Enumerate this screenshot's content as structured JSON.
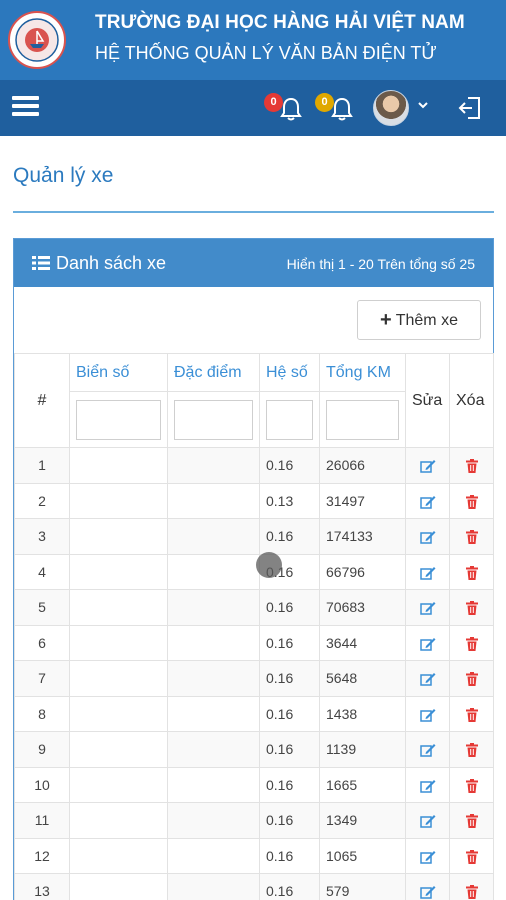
{
  "brand": {
    "title": "TRƯỜNG ĐẠI HỌC HÀNG HẢI VIỆT NAM",
    "subtitle": "HỆ THỐNG QUẢN LÝ VĂN BẢN ĐIỆN TỬ",
    "logo_icon": "university-seal-logo"
  },
  "navbar": {
    "menu_icon": "hamburger-icon",
    "notifications": [
      {
        "icon": "bell-icon",
        "count": "0",
        "color": "#e53935"
      },
      {
        "icon": "bell-icon",
        "count": "0",
        "color": "#e0a800"
      }
    ],
    "avatar_icon": "user-avatar",
    "logout_icon": "logout-icon"
  },
  "page": {
    "title": "Quản lý xe"
  },
  "panel": {
    "title": "Danh sách xe",
    "info": "Hiển thị 1 - 20 Trên tổng số 25",
    "add_button": "Thêm xe",
    "columns": [
      "#",
      "Biển số",
      "Đặc điểm",
      "Hệ số",
      "Tổng KM",
      "Sửa",
      "Xóa"
    ]
  },
  "rows": [
    {
      "n": "1",
      "plate": "",
      "feature": "",
      "coef": "0.16",
      "km": "26066"
    },
    {
      "n": "2",
      "plate": "",
      "feature": "",
      "coef": "0.13",
      "km": "31497"
    },
    {
      "n": "3",
      "plate": "",
      "feature": "",
      "coef": "0.16",
      "km": "174133"
    },
    {
      "n": "4",
      "plate": "",
      "feature": "",
      "coef": "0.16",
      "km": "66796"
    },
    {
      "n": "5",
      "plate": "",
      "feature": "",
      "coef": "0.16",
      "km": "70683"
    },
    {
      "n": "6",
      "plate": "",
      "feature": "",
      "coef": "0.16",
      "km": "3644"
    },
    {
      "n": "7",
      "plate": "",
      "feature": "",
      "coef": "0.16",
      "km": "5648"
    },
    {
      "n": "8",
      "plate": "",
      "feature": "",
      "coef": "0.16",
      "km": "1438"
    },
    {
      "n": "9",
      "plate": "",
      "feature": "",
      "coef": "0.16",
      "km": "1139"
    },
    {
      "n": "10",
      "plate": "",
      "feature": "",
      "coef": "0.16",
      "km": "1665"
    },
    {
      "n": "11",
      "plate": "",
      "feature": "",
      "coef": "0.16",
      "km": "1349"
    },
    {
      "n": "12",
      "plate": "",
      "feature": "",
      "coef": "0.16",
      "km": "1065"
    },
    {
      "n": "13",
      "plate": "",
      "feature": "",
      "coef": "0.16",
      "km": "579"
    }
  ],
  "colors": {
    "header_blue": "#2c78bd",
    "nav_blue": "#1f5f9e",
    "panel_blue": "#428bca",
    "link_blue": "#3b8fd6",
    "edit_icon": "#3b8fd6",
    "delete_icon": "#e53935"
  }
}
